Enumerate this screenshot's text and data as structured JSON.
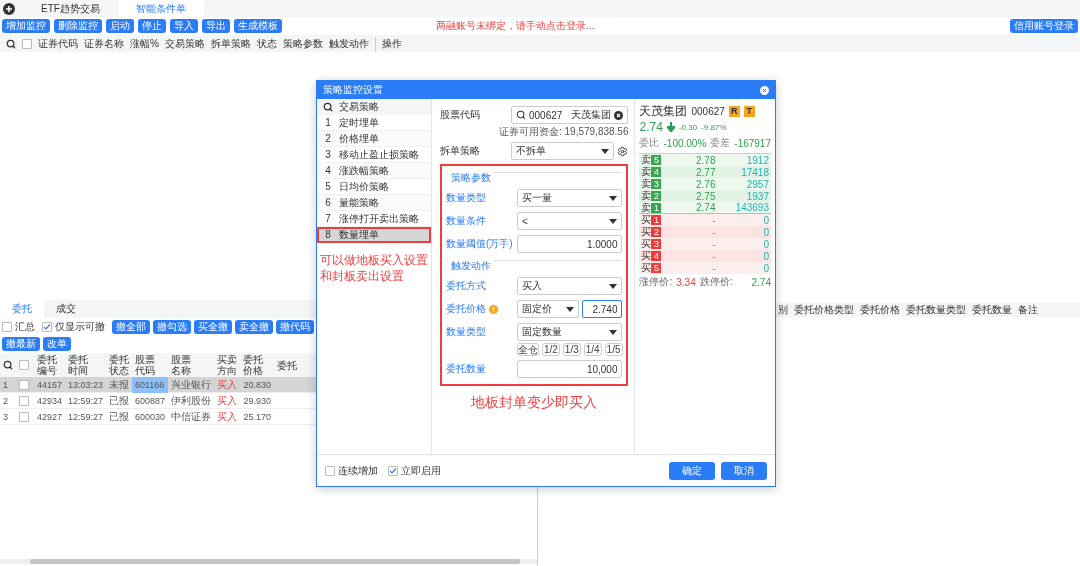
{
  "app_tabs": [
    {
      "label": "ETF趋势交易",
      "selected": false
    },
    {
      "label": "智能条件单",
      "selected": true
    }
  ],
  "toolbar": {
    "buttons": [
      "增加监控",
      "删除监控",
      "启动",
      "停止",
      "导入",
      "导出",
      "生成模板"
    ],
    "message": "两融账号未绑定，请手动点击登录...",
    "login_button": "信用账号登录"
  },
  "monitor_table": {
    "select_all_checked": false,
    "columns": [
      "证券代码",
      "证券名称",
      "涨幅%",
      "交易策略",
      "拆单策略",
      "状态",
      "策略参数",
      "触发动作"
    ],
    "action_column": "操作"
  },
  "orders_panel": {
    "tabs": [
      {
        "label": "委托",
        "selected": true
      },
      {
        "label": "成交",
        "selected": false
      }
    ],
    "filters": [
      {
        "label": "汇总",
        "checked": false
      },
      {
        "label": "仅显示可撤",
        "checked": true
      }
    ],
    "buttons": [
      "撤全部",
      "撤勾选",
      "买全撤",
      "卖全撤",
      "撤代码",
      "撤最新",
      "改单"
    ],
    "select_all_checked": false,
    "columns": [
      "委托编号",
      "委托时间",
      "委托状态",
      "股票代码",
      "股票名称",
      "买卖方向",
      "委托价格",
      "委托"
    ],
    "rows": [
      {
        "index": "1",
        "selected": true,
        "checked": false,
        "cells": [
          "44167",
          "13:03:23",
          "未报",
          "601166",
          "兴业银行",
          "买入",
          "20.830"
        ]
      },
      {
        "index": "2",
        "selected": false,
        "checked": false,
        "cells": [
          "42934",
          "12:59:27",
          "已报",
          "600887",
          "伊利股份",
          "买入",
          "29.930"
        ]
      },
      {
        "index": "3",
        "selected": false,
        "checked": false,
        "cells": [
          "42927",
          "12:59:27",
          "已报",
          "600030",
          "中信证券",
          "买入",
          "25.170"
        ]
      }
    ]
  },
  "side_table": {
    "columns": [
      "别",
      "委托价格类型",
      "委托价格",
      "委托数量类型",
      "委托数量",
      "备注"
    ]
  },
  "dialog": {
    "title": "策略监控设置",
    "strategies": {
      "header": "交易策略",
      "items": [
        {
          "number": "1",
          "label": "定时埋单",
          "selected": false,
          "annotated": false
        },
        {
          "number": "2",
          "label": "价格埋单",
          "selected": false,
          "annotated": false
        },
        {
          "number": "3",
          "label": "移动止盈止损策略",
          "selected": false,
          "annotated": false
        },
        {
          "number": "4",
          "label": "涨跌幅策略",
          "selected": false,
          "annotated": false
        },
        {
          "number": "5",
          "label": "日均价策略",
          "selected": false,
          "annotated": false
        },
        {
          "number": "6",
          "label": "量能策略",
          "selected": false,
          "annotated": false
        },
        {
          "number": "7",
          "label": "涨停打开卖出策略",
          "selected": false,
          "annotated": false
        },
        {
          "number": "8",
          "label": "数量埋单",
          "selected": true,
          "annotated": true
        }
      ]
    },
    "stock": {
      "label": "股票代码",
      "value": "000627",
      "name": "天茂集团",
      "funds": "证券可用资金: 19,579,838.56"
    },
    "split": {
      "label": "拆单策略",
      "value": "不拆单"
    },
    "groups": [
      {
        "legend": "策略参数",
        "rows": [
          {
            "kind": "select",
            "label": "数量类型",
            "value": "买一量"
          },
          {
            "kind": "select",
            "label": "数量条件",
            "value": "<"
          },
          {
            "kind": "input",
            "label": "数量阈值(万手)",
            "value": "1.0000"
          }
        ]
      },
      {
        "legend": "触发动作",
        "rows": [
          {
            "kind": "select",
            "label": "委托方式",
            "value": "买入"
          },
          {
            "kind": "price",
            "label": "委托价格",
            "select": "固定价",
            "value": "2.740"
          },
          {
            "kind": "select",
            "label": "数量类型",
            "value": "固定数量"
          },
          {
            "kind": "ratios",
            "options": [
              "全仓",
              "1/2",
              "1/3",
              "1/4",
              "1/5"
            ]
          },
          {
            "kind": "input",
            "label": "委托数量",
            "value": "10,000"
          }
        ]
      }
    ],
    "quote": {
      "name": "天茂集团",
      "code": "000627",
      "badges": [
        "R",
        "T"
      ],
      "price": "2.74",
      "falling": true,
      "change": "-0.30",
      "change_pct": "-9.87%",
      "ratio_label": "委比",
      "ratio": "-100.00%",
      "diff_label": "委差",
      "diff": "-167917",
      "asks": [
        {
          "label": "卖",
          "rank": "5",
          "price": "2.78",
          "volume": "1912"
        },
        {
          "label": "卖",
          "rank": "4",
          "price": "2.77",
          "volume": "17418"
        },
        {
          "label": "卖",
          "rank": "3",
          "price": "2.76",
          "volume": "2957"
        },
        {
          "label": "卖",
          "rank": "2",
          "price": "2.75",
          "volume": "1937"
        },
        {
          "label": "卖",
          "rank": "1",
          "price": "2.74",
          "volume": "143693"
        }
      ],
      "bids": [
        {
          "label": "买",
          "rank": "1",
          "price": "-",
          "volume": "0"
        },
        {
          "label": "买",
          "rank": "2",
          "price": "-",
          "volume": "0"
        },
        {
          "label": "买",
          "rank": "3",
          "price": "-",
          "volume": "0"
        },
        {
          "label": "买",
          "rank": "4",
          "price": "-",
          "volume": "0"
        },
        {
          "label": "买",
          "rank": "5",
          "price": "-",
          "volume": "0"
        }
      ],
      "limit_up_label": "涨停价:",
      "limit_up": "3.34",
      "limit_down_label": "跌停价:",
      "limit_down": "2.74"
    },
    "footer": {
      "options": [
        {
          "label": "连续增加",
          "checked": false
        },
        {
          "label": "立即启用",
          "checked": true
        }
      ],
      "buttons": [
        "确定",
        "取消"
      ]
    }
  },
  "annotations": {
    "left_note": [
      "可以做地板买入设置",
      "和封板卖出设置"
    ],
    "form_note": "地板封单变少即买入"
  }
}
